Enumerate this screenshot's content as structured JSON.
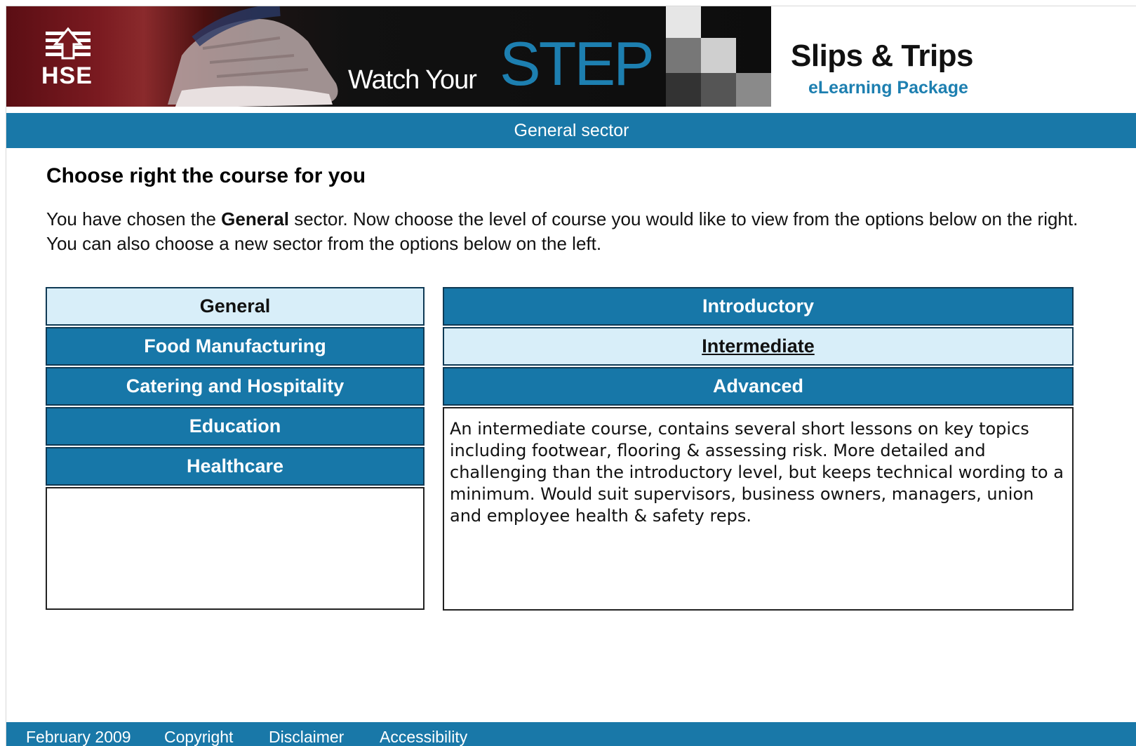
{
  "banner": {
    "logo_text": "HSE",
    "watch_text": "Watch Your",
    "step_text": "STEP",
    "title": "Slips & Trips",
    "subtitle": "eLearning Package"
  },
  "sector_bar": "General sector",
  "heading": "Choose right the course for you",
  "intro": {
    "part1": "You have chosen the ",
    "bold": "General",
    "part2": " sector. Now choose the level of course you would like to view from the options below on the right. You can also choose a new sector from the options below on the left."
  },
  "sectors": [
    {
      "label": "General",
      "selected": true
    },
    {
      "label": "Food Manufacturing",
      "selected": false
    },
    {
      "label": "Catering and Hospitality",
      "selected": false
    },
    {
      "label": "Education",
      "selected": false
    },
    {
      "label": "Healthcare",
      "selected": false
    }
  ],
  "levels": [
    {
      "label": "Introductory",
      "selected": false
    },
    {
      "label": "Intermediate",
      "selected": true
    },
    {
      "label": "Advanced",
      "selected": false
    }
  ],
  "description": "An intermediate course, contains several short lessons on key topics including footwear, flooring & assessing risk. More detailed and challenging than the introductory level, but keeps technical wording to a minimum. Would suit supervisors, business owners, managers, union and employee health & safety reps.",
  "footer": {
    "date": "February 2009",
    "copyright": "Copyright",
    "disclaimer": "Disclaimer",
    "accessibility": "Accessibility"
  },
  "colors": {
    "brand_blue": "#1978a8",
    "selected_bg": "#d8eef9",
    "banner_red": "#7a1a20"
  }
}
